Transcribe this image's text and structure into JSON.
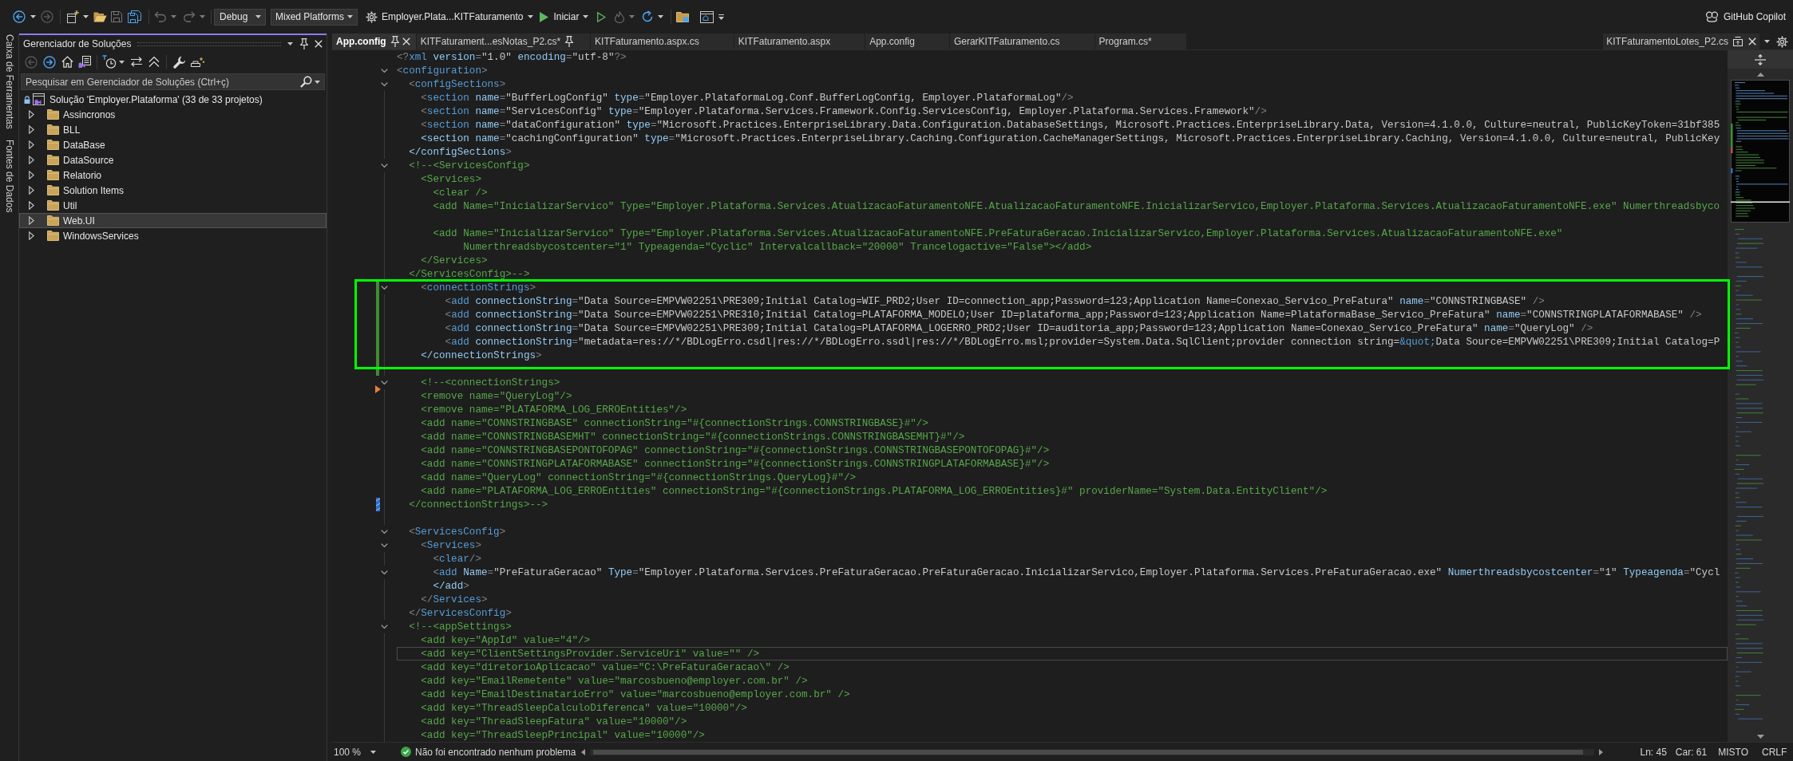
{
  "toolbar": {
    "configuration": "Debug",
    "platform": "Mixed Platforms",
    "startup_project": "Employer.Plata...KITFaturamento",
    "start": "Iniciar",
    "copilot": "GitHub Copilot"
  },
  "side_tabs": [
    "Caixa de Ferramentas",
    "Fontes de Dados"
  ],
  "solution_explorer": {
    "title": "Gerenciador de Soluções",
    "search": {
      "placeholder": "Pesquisar em Gerenciador de Soluções (Ctrl+ç)"
    },
    "tree": [
      {
        "label": "Solução 'Employer.Plataforma' (33 de 33 projetos)",
        "selected": false,
        "children": [
          {
            "label": "Assincronos",
            "expanded": false,
            "selected": false
          },
          {
            "label": "BLL",
            "expanded": false,
            "selected": false
          },
          {
            "label": "DataBase",
            "expanded": false,
            "selected": false
          },
          {
            "label": "DataSource",
            "expanded": false,
            "selected": false
          },
          {
            "label": "Relatorio",
            "expanded": false,
            "selected": false
          },
          {
            "label": "Solution Items",
            "expanded": false,
            "selected": false
          },
          {
            "label": "Util",
            "expanded": false,
            "selected": false
          },
          {
            "label": "Web.UI",
            "expanded": false,
            "selected": true
          },
          {
            "label": "WindowsServices",
            "expanded": false,
            "selected": false
          }
        ]
      }
    ]
  },
  "editor": {
    "tabs": [
      {
        "label": "App.config",
        "selected": true,
        "pinned": true
      },
      {
        "label": "KITFaturament...esNotas_P2.cs*",
        "selected": false,
        "pinned": true
      },
      {
        "label": "KITFaturamento.aspx.cs",
        "selected": false,
        "pinned": false
      },
      {
        "label": "KITFaturamento.aspx",
        "selected": false,
        "pinned": false
      },
      {
        "label": "App.config",
        "selected": false,
        "pinned": false
      },
      {
        "label": "GerarKITFaturamento.cs",
        "selected": false,
        "pinned": false
      },
      {
        "label": "Program.cs*",
        "selected": false,
        "pinned": false
      }
    ],
    "preview_tab": {
      "label": "KITFaturamentoLotes_P2.cs"
    },
    "lines": [
      {
        "kind": "code",
        "text": "<?xml version=\"1.0\" encoding=\"utf-8\"?>",
        "fold": false,
        "current": false
      },
      {
        "kind": "code",
        "text": "<configuration>",
        "fold": true,
        "current": false
      },
      {
        "kind": "code",
        "text": "  <configSections>",
        "fold": true,
        "current": false
      },
      {
        "kind": "code",
        "text": "    <section name=\"BufferLogConfig\" type=\"Employer.PlataformaLog.Conf.BufferLogConfig, Employer.PlataformaLog\"/>",
        "fold": false,
        "current": false
      },
      {
        "kind": "code",
        "text": "    <section name=\"ServicesConfig\" type=\"Employer.Plataforma.Services.Framework.Config.ServicesConfig, Employer.Plataforma.Services.Framework\"/>",
        "fold": false,
        "current": false
      },
      {
        "kind": "code",
        "text": "    <section name=\"dataConfiguration\" type=\"Microsoft.Practices.EnterpriseLibrary.Data.Configuration.DatabaseSettings, Microsoft.Practices.EnterpriseLibrary.Data, Version=4.1.0.0, Culture=neutral, PublicKeyToken=31bf385",
        "fold": false,
        "current": false
      },
      {
        "kind": "code",
        "text": "    <section name=\"cachingConfiguration\" type=\"Microsoft.Practices.EnterpriseLibrary.Caching.Configuration.CacheManagerSettings, Microsoft.Practices.EnterpriseLibrary.Caching, Version=4.1.0.0, Culture=neutral, PublicKey",
        "fold": false,
        "current": false
      },
      {
        "kind": "code",
        "text": "  </configSections>",
        "fold": false,
        "current": false
      },
      {
        "kind": "code",
        "text": "  <!--<ServicesConfig>",
        "fold": true,
        "current": false
      },
      {
        "kind": "code",
        "text": "    <Services>",
        "fold": false,
        "current": false
      },
      {
        "kind": "code",
        "text": "      <clear />",
        "fold": false,
        "current": false
      },
      {
        "kind": "code",
        "text": "      <add Name=\"InicializarServico\" Type=\"Employer.Plataforma.Services.AtualizacaoFaturamentoNFE.AtualizacaoFaturamentoNFE.InicializarServico,Employer.Plataforma.Services.AtualizacaoFaturamentoNFE.exe\" Numerthreadsbyco",
        "fold": false,
        "current": false
      },
      {
        "kind": "blank",
        "current": false
      },
      {
        "kind": "code",
        "text": "      <add Name=\"InicializarServico\" Type=\"Employer.Plataforma.Services.AtualizacaoFaturamentoNFE.PreFaturaGeracao.InicializarServico,Employer.Plataforma.Services.AtualizacaoFaturamentoNFE.exe\"",
        "fold": false,
        "current": false
      },
      {
        "kind": "code",
        "text": "           Numerthreadsbycostcenter=\"1\" Typeagenda=\"Cyclic\" Intervalcallback=\"20000\" Trancelogactive=\"False\"></add>",
        "fold": false,
        "current": false
      },
      {
        "kind": "code",
        "text": "    </Services>",
        "fold": false,
        "current": false
      },
      {
        "kind": "code",
        "text": "  </ServicesConfig>-->",
        "fold": false,
        "current": false
      },
      {
        "kind": "changed",
        "lines": [
          {
            "kind": "annotated",
            "lines": [
              {
                "kind": "code",
                "text": "    <connectionStrings>",
                "fold": true,
                "current": false
              },
              {
                "kind": "code",
                "text": "        <add connectionString=\"Data Source=EMPVW02251\\PRE309;Initial Catalog=WIF_PRD2;User ID=connection_app;Password=123;Application Name=Conexao_Servico_PreFatura\" name=\"CONNSTRINGBASE\" />",
                "fold": false,
                "current": false
              },
              {
                "kind": "code",
                "text": "        <add connectionString=\"Data Source=EMPVW02251\\PRE310;Initial Catalog=PLATAFORMA_MODELO;User ID=plataforma_app;Password=123;Application Name=PlataformaBase_Servico_PreFatura\" name=\"CONNSTRINGPLATAFORMABASE\" />",
                "fold": false,
                "current": false
              },
              {
                "kind": "code",
                "text": "        <add connectionString=\"Data Source=EMPVW02251\\PRE309;Initial Catalog=PLATAFORMA_LOGERRO_PRD2;User ID=auditoria_app;Password=123;Application Name=Conexao_Servico_PreFatura\" name=\"QueryLog\" />",
                "fold": false,
                "current": false
              },
              {
                "kind": "code",
                "text": "        <add connectionString=\"metadata=res://*/BDLogErro.csdl|res://*/BDLogErro.ssdl|res://*/BDLogErro.msl;provider=System.Data.SqlClient;provider connection string=&quot;Data Source=EMPVW02251\\PRE309;Initial Catalog=P",
                "fold": false,
                "current": false
              },
              {
                "kind": "code",
                "text": "    </connectionStrings>",
                "fold": false,
                "current": false
              }
            ]
          },
          {
            "kind": "blank",
            "current": false
          }
        ]
      },
      {
        "kind": "code",
        "text": "    <!--<connectionStrings>",
        "fold": true,
        "current": false
      },
      {
        "kind": "code",
        "text": "    <remove name=\"QueryLog\"/>",
        "fold": false,
        "current": false,
        "marker": {
          "kind": "deleted"
        }
      },
      {
        "kind": "code",
        "text": "    <remove name=\"PLATAFORMA_LOG_ERROEntities\"/>",
        "fold": false,
        "current": false
      },
      {
        "kind": "code",
        "text": "    <add name=\"CONNSTRINGBASE\" connectionString=\"#{connectionStrings.CONNSTRINGBASE}#\"/>",
        "fold": false,
        "current": false
      },
      {
        "kind": "code",
        "text": "    <add name=\"CONNSTRINGBASEMHT\" connectionString=\"#{connectionStrings.CONNSTRINGBASEMHT}#\"/>",
        "fold": false,
        "current": false
      },
      {
        "kind": "code",
        "text": "    <add name=\"CONNSTRINGBASEPONTOFOPAG\" connectionString=\"#{connectionStrings.CONNSTRINGBASEPONTOFOPAG}#\"/>",
        "fold": false,
        "current": false
      },
      {
        "kind": "code",
        "text": "    <add name=\"CONNSTRINGPLATAFORMABASE\" connectionString=\"#{connectionStrings.CONNSTRINGPLATAFORMABASE}#\"/>",
        "fold": false,
        "current": false
      },
      {
        "kind": "code",
        "text": "    <add name=\"QueryLog\" connectionString=\"#{connectionStrings.QueryLog}#\"/>",
        "fold": false,
        "current": false
      },
      {
        "kind": "code",
        "text": "    <add name=\"PLATAFORMA_LOG_ERROEntities\" connectionString=\"#{connectionStrings.PLATAFORMA_LOG_ERROEntities}#\" providerName=\"System.Data.EntityClient\"/>",
        "fold": false,
        "current": false
      },
      {
        "kind": "code",
        "text": "  </connectionStrings>-->",
        "fold": false,
        "current": false,
        "marker": {
          "kind": "reverted"
        }
      },
      {
        "kind": "blank",
        "current": false
      },
      {
        "kind": "code",
        "text": "  <ServicesConfig>",
        "fold": true,
        "current": false
      },
      {
        "kind": "code",
        "text": "    <Services>",
        "fold": true,
        "current": false
      },
      {
        "kind": "code",
        "text": "      <clear/>",
        "fold": false,
        "current": false
      },
      {
        "kind": "code",
        "text": "      <add Name=\"PreFaturaGeracao\" Type=\"Employer.Plataforma.Services.PreFaturaGeracao.PreFaturaGeracao.InicializarServico,Employer.Plataforma.Services.PreFaturaGeracao.exe\" Numerthreadsbycostcenter=\"1\" Typeagenda=\"Cycl",
        "fold": true,
        "current": false
      },
      {
        "kind": "code",
        "text": "      </add>",
        "fold": false,
        "current": false
      },
      {
        "kind": "code",
        "text": "    </Services>",
        "fold": false,
        "current": false
      },
      {
        "kind": "code",
        "text": "  </ServicesConfig>",
        "fold": false,
        "current": false
      },
      {
        "kind": "code",
        "text": "  <!--<appSettings>",
        "fold": true,
        "current": false
      },
      {
        "kind": "code",
        "text": "    <add key=\"AppId\" value=\"4\"/>",
        "fold": false,
        "current": false
      },
      {
        "kind": "code",
        "text": "    <add key=\"ClientSettingsProvider.ServiceUri\" value=\"\" />",
        "fold": false,
        "current": true
      },
      {
        "kind": "code",
        "text": "    <add key=\"diretorioAplicacao\" value=\"C:\\PreFaturaGeracao\\\" />",
        "fold": false,
        "current": false
      },
      {
        "kind": "code",
        "text": "    <add key=\"EmailRemetente\" value=\"marcosbueno@employer.com.br\" />",
        "fold": false,
        "current": false
      },
      {
        "kind": "code",
        "text": "    <add key=\"EmailDestinatarioErro\" value=\"marcosbueno@employer.com.br\" />",
        "fold": false,
        "current": false
      },
      {
        "kind": "code",
        "text": "    <add key=\"ThreadSleepCalculoDiferenca\" value=\"10000\"/>",
        "fold": false,
        "current": false
      },
      {
        "kind": "code",
        "text": "    <add key=\"ThreadSleepFatura\" value=\"10000\"/>",
        "fold": false,
        "current": false
      },
      {
        "kind": "code",
        "text": "    <add key=\"ThreadSleepPrincipal\" value=\"10000\"/>",
        "fold": false,
        "current": false
      }
    ],
    "status_bar": {
      "zoom": "100 %",
      "issues": "Não foi encontrado nenhum problema",
      "line": "Ln: 45",
      "column": "Car: 61",
      "indentation": "MISTO",
      "line_endings": "CRLF"
    }
  }
}
